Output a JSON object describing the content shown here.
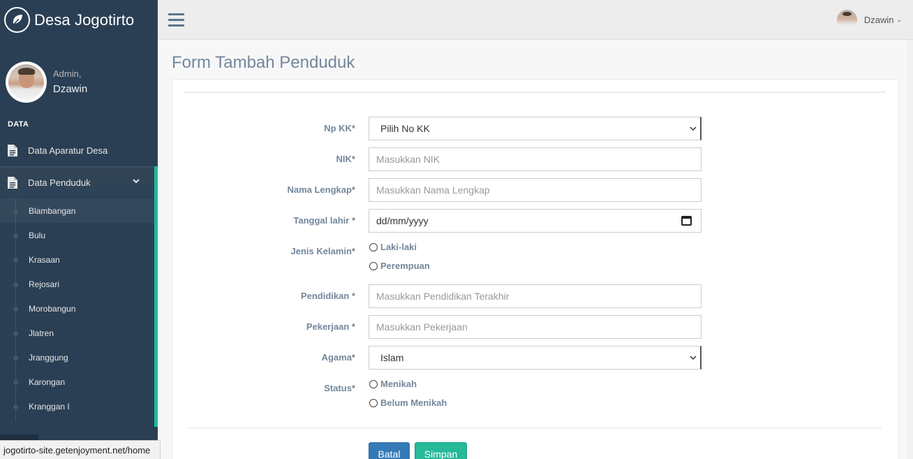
{
  "brand": {
    "title": "Desa Jogotirto"
  },
  "profile": {
    "welcome": "Admin,",
    "name": "Dzawin"
  },
  "sidebar": {
    "section_title": "DATA",
    "items": [
      {
        "label": "Data Aparatur Desa",
        "icon": "document-icon"
      },
      {
        "label": "Data Penduduk",
        "icon": "document-icon",
        "expanded": true
      }
    ],
    "subitems": [
      "Blambangan",
      "Bulu",
      "Krasaan",
      "Rejosari",
      "Morobangun",
      "Jlatren",
      "Jranggung",
      "Karongan",
      "Kranggan I"
    ]
  },
  "topnav": {
    "user_name": "Dzawin",
    "menu_icon": "hamburger-icon"
  },
  "page": {
    "title": "Form Tambah Penduduk"
  },
  "form": {
    "no_kk": {
      "label": "Np KK*",
      "value": "Pilih No KK"
    },
    "nik": {
      "label": "NIK*",
      "placeholder": "Masukkan NIK"
    },
    "nama": {
      "label": "Nama Lengkap*",
      "placeholder": "Masukkan Nama Lengkap"
    },
    "tanggal": {
      "label": "Tanggal lahir *",
      "value": "dd/mm/yyyy"
    },
    "jenis_kelamin": {
      "label": "Jenis Kelamin*",
      "options": [
        "Laki-laki",
        "Perempuan"
      ]
    },
    "pendidikan": {
      "label": "Pendidikan *",
      "placeholder": "Masukkan Pendidikan Terakhir"
    },
    "pekerjaan": {
      "label": "Pekerjaan *",
      "placeholder": "Masukkan Pekerjaan"
    },
    "agama": {
      "label": "Agama*",
      "value": "Islam"
    },
    "status": {
      "label": "Status*",
      "options": [
        "Menikah",
        "Belum Menikah"
      ]
    },
    "buttons": {
      "cancel": "Batal",
      "save": "Simpan"
    }
  },
  "browser": {
    "status_url": "jogotirto-site.getenjoyment.net/home"
  },
  "colors": {
    "sidebar": "#2a3f54",
    "accent": "#1abb9c",
    "primary": "#337ab7",
    "success": "#26b99a"
  }
}
